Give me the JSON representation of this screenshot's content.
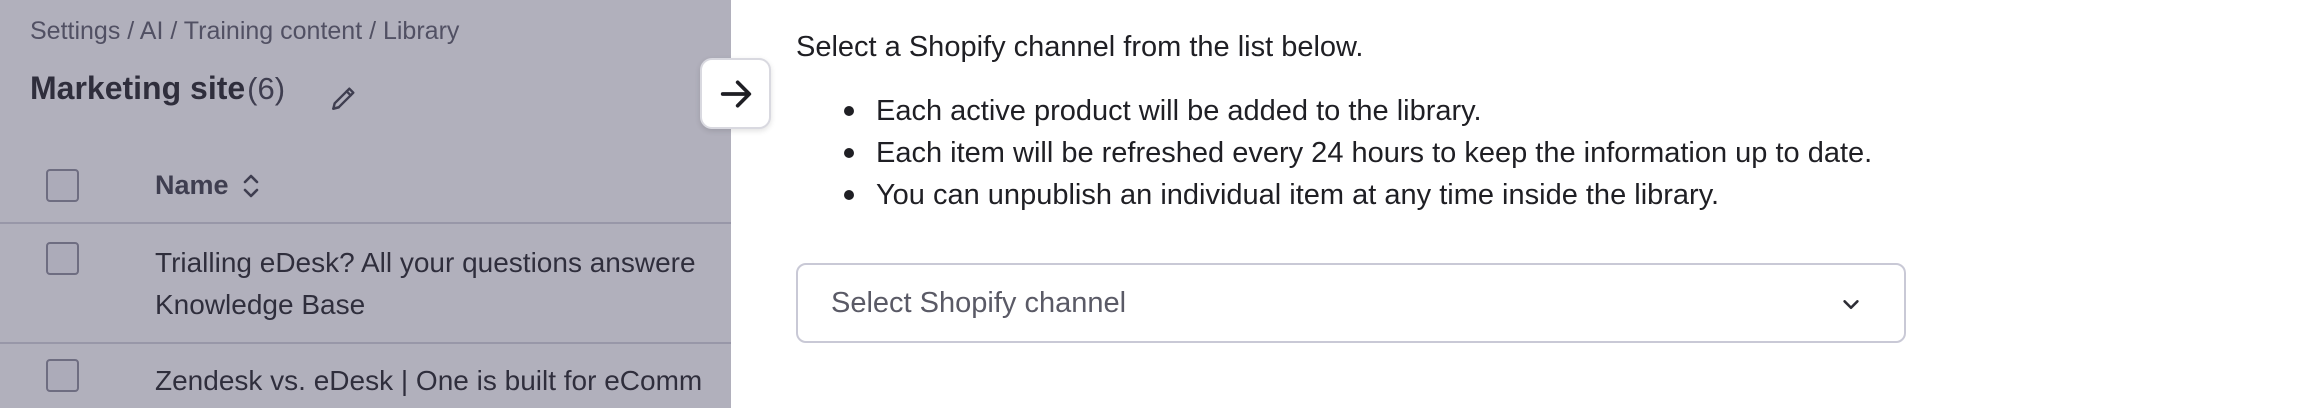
{
  "background_page": {
    "breadcrumb": "Settings / AI / Training content / Library",
    "title": "Marketing site",
    "count": "(6)",
    "table": {
      "columns": {
        "name": "Name"
      },
      "rows": [
        {
          "line1": "Trialling eDesk? All your questions answere",
          "line2": "Knowledge Base"
        },
        {
          "line1": "Zendesk vs. eDesk | One is built for eComm"
        }
      ]
    }
  },
  "drawer": {
    "intro": "Select a Shopify channel from the list below.",
    "bullets": [
      "Each active product will be added to the library.",
      "Each item will be refreshed every 24 hours to keep the information up to date.",
      "You can unpublish an individual item at any time inside the library."
    ],
    "select": {
      "placeholder": "Select Shopify channel"
    }
  },
  "icons": {
    "edit": "pencil-icon",
    "sort": "sort-icon",
    "collapse": "arrow-right-icon",
    "dropdown": "chevron-down-icon"
  },
  "colors": {
    "overlay": "#46425f",
    "text": "#1f1f24",
    "border": "#c9c9d6"
  }
}
